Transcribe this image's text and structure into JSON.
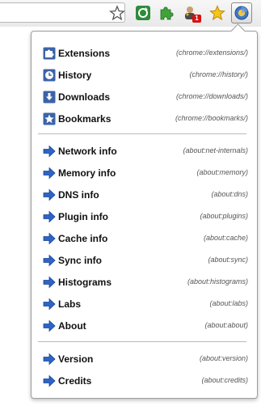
{
  "groups": [
    {
      "items": [
        {
          "label": "Extensions",
          "url": "(chrome://extensions/)",
          "icon": "puzzle-icon"
        },
        {
          "label": "History",
          "url": "(chrome://history/)",
          "icon": "clock-icon"
        },
        {
          "label": "Downloads",
          "url": "(chrome://downloads/)",
          "icon": "download-icon"
        },
        {
          "label": "Bookmarks",
          "url": "(chrome://bookmarks/)",
          "icon": "star-icon"
        }
      ]
    },
    {
      "items": [
        {
          "label": "Network info",
          "url": "(about:net-internals)",
          "icon": "arrow-icon"
        },
        {
          "label": "Memory info",
          "url": "(about:memory)",
          "icon": "arrow-icon"
        },
        {
          "label": "DNS info",
          "url": "(about:dns)",
          "icon": "arrow-icon"
        },
        {
          "label": "Plugin info",
          "url": "(about:plugins)",
          "icon": "arrow-icon"
        },
        {
          "label": "Cache info",
          "url": "(about:cache)",
          "icon": "arrow-icon"
        },
        {
          "label": "Sync info",
          "url": "(about:sync)",
          "icon": "arrow-icon"
        },
        {
          "label": "Histograms",
          "url": "(about:histograms)",
          "icon": "arrow-icon"
        },
        {
          "label": "Labs",
          "url": "(about:labs)",
          "icon": "arrow-icon"
        },
        {
          "label": "About",
          "url": "(about:about)",
          "icon": "arrow-icon"
        }
      ]
    },
    {
      "items": [
        {
          "label": "Version",
          "url": "(about:version)",
          "icon": "arrow-icon"
        },
        {
          "label": "Credits",
          "url": "(about:credits)",
          "icon": "arrow-icon"
        }
      ]
    }
  ],
  "toolbar": {
    "badge_count": "1",
    "icons": [
      "bookmark-star-icon",
      "recycle-extension-icon",
      "puzzle-extension-icon",
      "user-badge-extension-icon",
      "gold-star-extension-icon",
      "chrome-pages-extension-icon"
    ]
  },
  "colors": {
    "arrow": "#2d64c8",
    "icon_blue": "#3b64a8",
    "badge": "#d81010",
    "star_gold": "#f5c518"
  }
}
